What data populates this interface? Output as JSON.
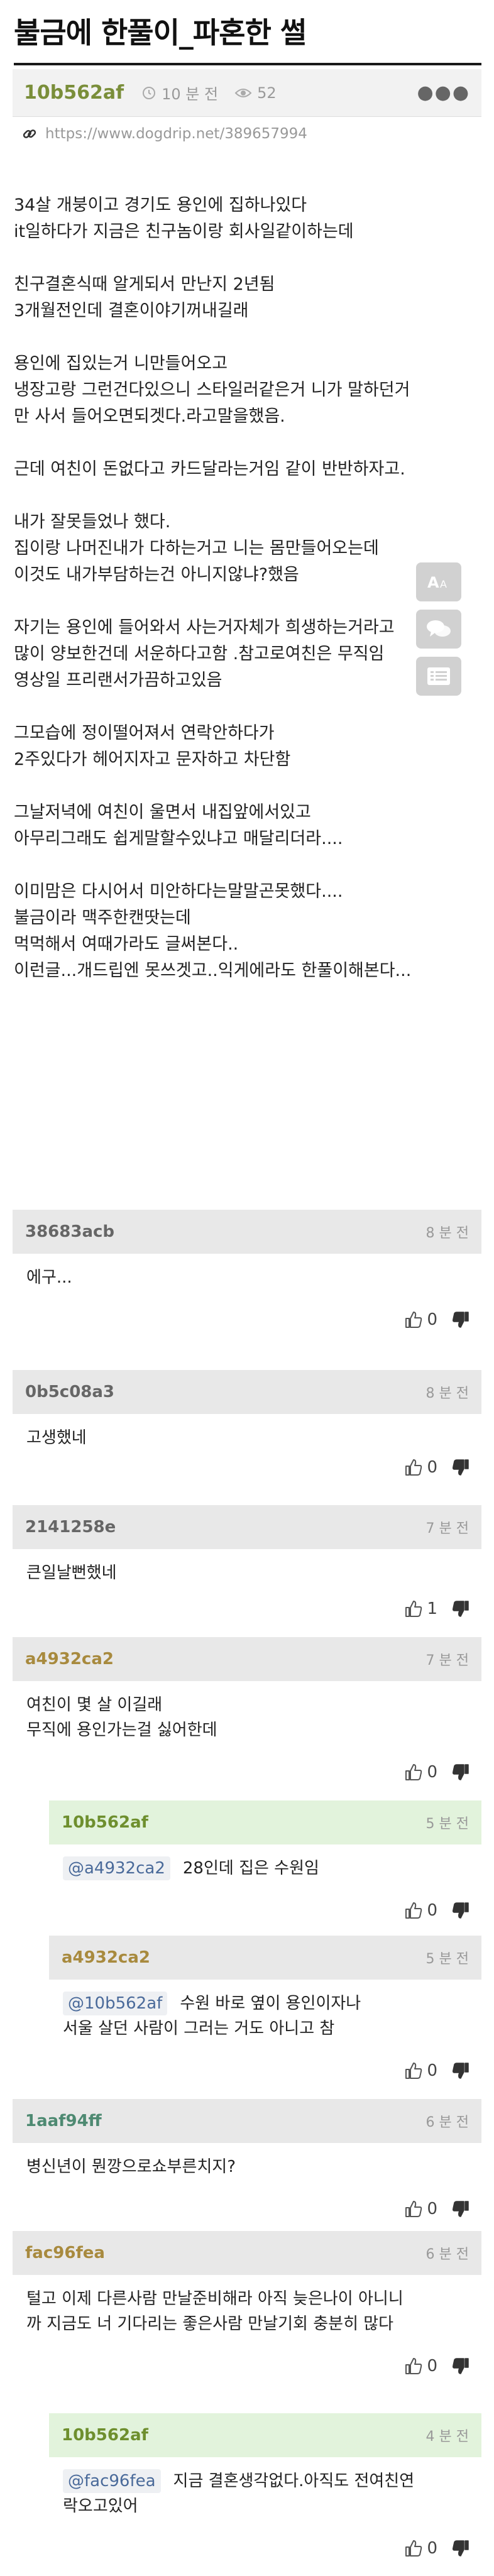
{
  "post": {
    "title": "불금에 한풀이_파혼한 썰",
    "author": "10b562af",
    "time": "10 분 전",
    "views": "52",
    "url": "https://www.dogdrip.net/389657994",
    "paragraphs": [
      "34살 개붕이고 경기도 용인에 집하나있다\nit일하다가 지금은 친구놈이랑 회사일같이하는데",
      "친구결혼식때 알게되서 만난지 2년됨\n3개월전인데  결혼이야기꺼내길래",
      "용인에 집있는거 니만들어오고\n냉장고랑 그런건다있으니 스타일러같은거 니가 말하던거\n만 사서 들어오면되겟다.라고말을했음.",
      "근데 여친이 돈없다고 카드달라는거임 같이 반반하자고.",
      "내가 잘못들었나 했다.\n집이랑 나머진내가 다하는거고 니는 몸만들어오는데\n이것도 내가부담하는건 아니지않냐?했음",
      "자기는 용인에 들어와서 사는거자체가 희생하는거라고\n많이 양보한건데 서운하다고함 .참고로여친은 무직임\n영상일 프리랜서가끔하고있음",
      "그모습에 정이떨어져서 연락안하다가\n2주있다가 헤어지자고 문자하고 차단함",
      "그날저녁에 여친이 울면서 내집앞에서있고\n아무리그래도 쉽게말할수있냐고 매달리더라....",
      "이미맘은 다시어서 미안하다는말말곤못했다....\n불금이라 맥주한캔땃는데\n먹먹해서 여때가라도 글써본다..\n이런글...개드립엔 못쓰겟고..익게에라도 한풀이해본다..."
    ]
  },
  "comments": [
    {
      "author": "38683acb",
      "time": "8 분 전",
      "text": "에구...",
      "up": "0"
    },
    {
      "author": "0b5c08a3",
      "time": "8 분 전",
      "text": "고생했네",
      "up": "0"
    },
    {
      "author": "2141258e",
      "time": "7 분 전",
      "text": "큰일날뻔했네",
      "up": "1"
    },
    {
      "author": "a4932ca2",
      "time": "7 분 전",
      "text": "여친이 몇 살 이길래\n무직에 용인가는걸 싫어한데",
      "up": "0"
    },
    {
      "author": "10b562af",
      "time": "5 분 전",
      "mention": "@a4932ca2",
      "text": "28인데 집은 수원임",
      "up": "0"
    },
    {
      "author": "a4932ca2",
      "time": "5 분 전",
      "mention": "@10b562af",
      "text": "수원 바로 옆이 용인이자나\n서울 살던 사람이 그러는 거도 아니고 참",
      "up": "0"
    },
    {
      "author": "1aaf94ff",
      "time": "6 분 전",
      "text": "병신년이 뭔깡으로쇼부른치지?",
      "up": "0"
    },
    {
      "author": "fac96fea",
      "time": "6 분 전",
      "text": "털고 이제 다른사람 만날준비해라 아직 늦은나이 아니니\n까 지금도 너 기다리는 좋은사람 만날기회 충분히 많다",
      "up": "0"
    },
    {
      "author": "10b562af",
      "time": "4 분 전",
      "mention": "@fac96fea",
      "text": "지금 결혼생각없다.아직도 전여친연\n락오고있어",
      "up": "0"
    }
  ],
  "icons": {
    "clock": "clock-icon",
    "eye": "eye-icon",
    "more": "more-icon",
    "link": "link-icon",
    "thumbs_up": "thumbs-up-icon",
    "thumbs_down": "thumbs-down-icon"
  },
  "colors": {
    "author_green": "#7a8e3a",
    "reply_bg": "#e2f3dc",
    "comment_head_bg": "#e8e8e8"
  }
}
